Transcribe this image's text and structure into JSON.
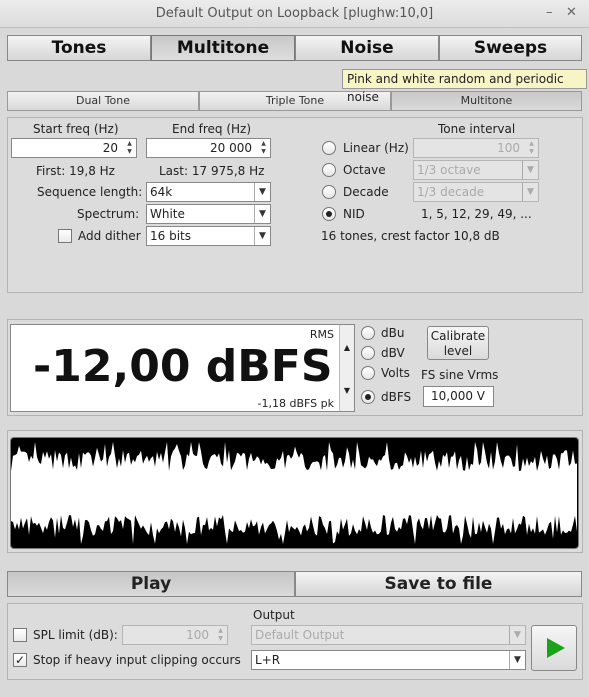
{
  "window": {
    "title": "Default Output on Loopback [plughw:10,0]",
    "minimize_glyph": "–",
    "close_glyph": "✕"
  },
  "main_tabs": [
    "Tones",
    "Multitone",
    "Noise",
    "Sweeps"
  ],
  "tooltip": "Pink and white random and periodic noise",
  "sub_tabs": [
    "Dual Tone",
    "Triple Tone",
    "Multitone"
  ],
  "freq": {
    "start_label": "Start freq (Hz)",
    "start_value": "20",
    "end_label": "End freq (Hz)",
    "end_value": "20 000",
    "first": "First: 19,8 Hz",
    "last": "Last: 17 975,8 Hz"
  },
  "sequence": {
    "label": "Sequence length:",
    "value": "64k"
  },
  "spectrum": {
    "label": "Spectrum:",
    "value": "White"
  },
  "dither": {
    "label": "Add dither",
    "value": "16 bits"
  },
  "interval": {
    "header": "Tone interval",
    "linear_label": "Linear (Hz)",
    "linear_value": "100",
    "octave_label": "Octave",
    "octave_value": "1/3 octave",
    "decade_label": "Decade",
    "decade_value": "1/3 decade",
    "nid_label": "NID",
    "nid_value": "1, 5, 12, 29, 49, ...",
    "summary": "16 tones, crest factor 10,8 dB"
  },
  "level": {
    "rms_label": "RMS",
    "value": "-12,00 dBFS",
    "peak": "-1,18 dBFS pk",
    "units": [
      "dBu",
      "dBV",
      "Volts",
      "dBFS"
    ],
    "calibrate": "Calibrate level",
    "fs_label": "FS sine Vrms",
    "fs_value": "10,000 V"
  },
  "actions": {
    "play": "Play",
    "save": "Save to file"
  },
  "output": {
    "spl_label": "SPL limit (dB):",
    "spl_value": "100",
    "clip_label": "Stop if heavy input clipping occurs",
    "output_label": "Output",
    "device": "Default Output",
    "channels": "L+R"
  },
  "colors": {
    "play_icon": "#1aa31a",
    "tooltip_bg": "#f7f4c6",
    "waveform_bg": "#000000",
    "waveform_fg": "#ffffff"
  }
}
